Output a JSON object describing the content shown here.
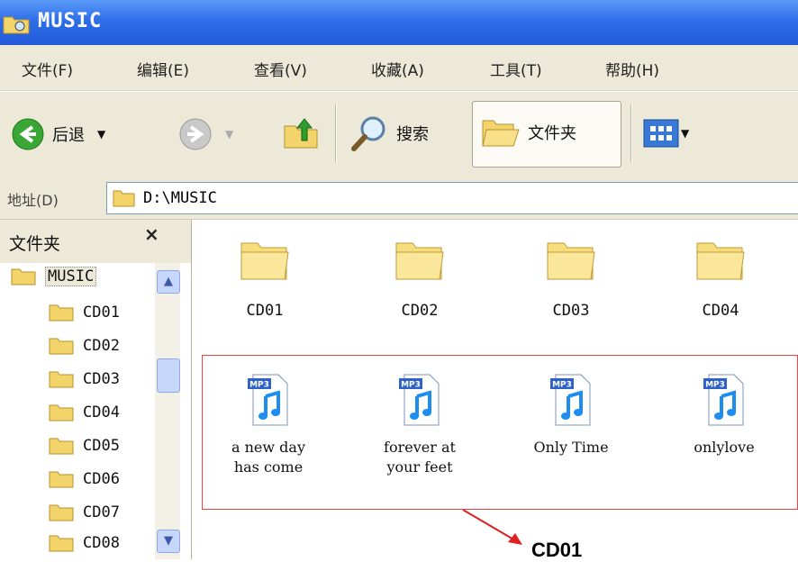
{
  "window": {
    "title": "MUSIC"
  },
  "menu": [
    "文件(F)",
    "编辑(E)",
    "查看(V)",
    "收藏(A)",
    "工具(T)",
    "帮助(H)"
  ],
  "toolbar": {
    "back_label": "后退",
    "search_label": "搜索",
    "folders_label": "文件夹"
  },
  "address": {
    "label": "地址(D)",
    "path": "D:\\MUSIC"
  },
  "folder_pane": {
    "title": "文件夹",
    "close": "×",
    "root": "MUSIC",
    "children": [
      "CD01",
      "CD02",
      "CD03",
      "CD04",
      "CD05",
      "CD06",
      "CD07",
      "CD08"
    ]
  },
  "content": {
    "folders": [
      "CD01",
      "CD02",
      "CD03",
      "CD04"
    ],
    "files": [
      {
        "line1": "a new day",
        "line2": "has come",
        "badge": "MP3"
      },
      {
        "line1": "forever at",
        "line2": "your feet",
        "badge": "MP3"
      },
      {
        "line1": "Only Time",
        "line2": "",
        "badge": "MP3"
      },
      {
        "line1": "onlylove",
        "line2": "",
        "badge": "MP3"
      }
    ]
  },
  "annotation": {
    "label": "CD01"
  },
  "colors": {
    "titlebar": "#2e6fe9",
    "highlight_box": "#f04040",
    "arrow": "#e02020"
  }
}
